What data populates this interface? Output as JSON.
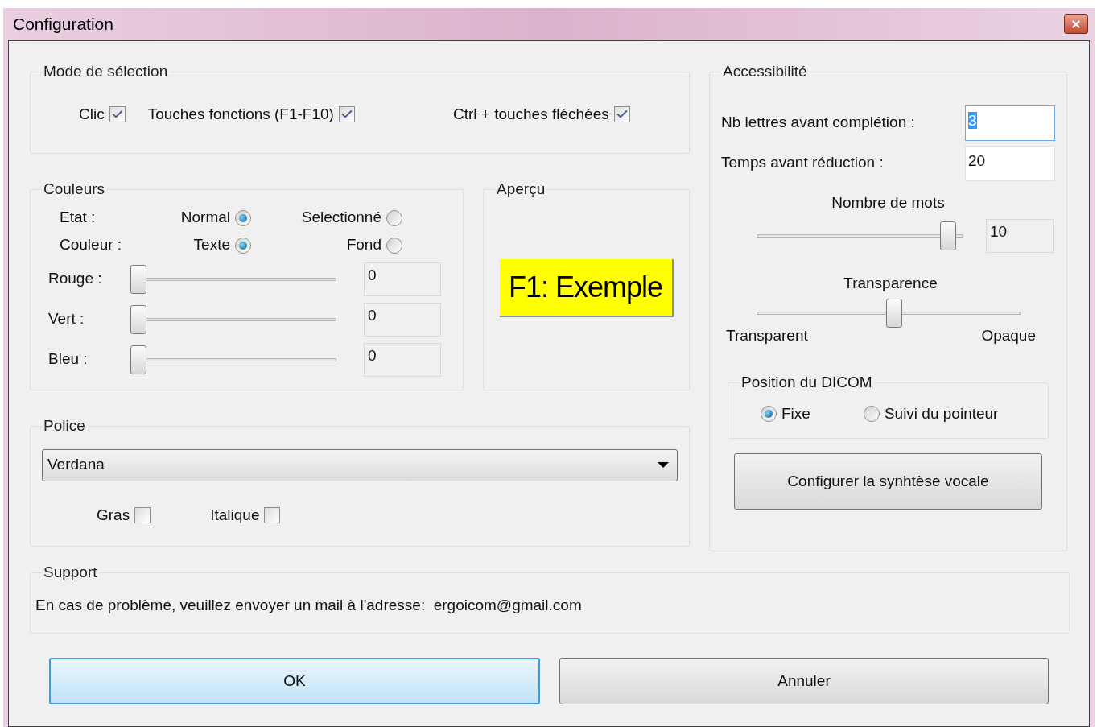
{
  "window": {
    "title": "Configuration"
  },
  "selection_mode": {
    "title": "Mode de sélection",
    "options": [
      {
        "label": "Clic",
        "checked": true
      },
      {
        "label": "Touches fonctions (F1-F10)",
        "checked": true
      },
      {
        "label": "Ctrl + touches fléchées",
        "checked": true
      }
    ]
  },
  "colors": {
    "title": "Couleurs",
    "rows": [
      {
        "label": "Etat :",
        "options": [
          {
            "label": "Normal",
            "selected": true
          },
          {
            "label": "Selectionné",
            "selected": false
          }
        ]
      },
      {
        "label": "Couleur :",
        "options": [
          {
            "label": "Texte",
            "selected": true
          },
          {
            "label": "Fond",
            "selected": false
          }
        ]
      }
    ],
    "channels": [
      {
        "label": "Rouge :",
        "level": 0,
        "value": "0"
      },
      {
        "label": "Vert :",
        "level": 0,
        "value": "0"
      },
      {
        "label": "Bleu :",
        "level": 0,
        "value": "0"
      }
    ]
  },
  "preview": {
    "title": "Aperçu",
    "sample": "F1: Exemple"
  },
  "font": {
    "title": "Police",
    "value": "Verdana",
    "options": [
      {
        "label": "Gras",
        "checked": false
      },
      {
        "label": "Italique",
        "checked": false
      }
    ]
  },
  "accessibility": {
    "title": "Accessibilité",
    "fields": [
      {
        "label": "Nb lettres avant complétion :",
        "value": "3",
        "focused": true
      },
      {
        "label": "Temps avant réduction :",
        "value": "20",
        "focused": false
      }
    ],
    "word_count": {
      "title": "Nombre de mots",
      "level": 0.96,
      "value": "10"
    },
    "transparency": {
      "title": "Transparence",
      "level": 0.52,
      "min_label": "Transparent",
      "max_label": "Opaque"
    },
    "dicom_position": {
      "title": "Position du DICOM",
      "options": [
        {
          "label": "Fixe",
          "selected": true
        },
        {
          "label": "Suivi du pointeur",
          "selected": false
        }
      ]
    },
    "voice_button": "Configurer la synhtèse vocale"
  },
  "support": {
    "title": "Support",
    "message": "En cas de problème, veuillez envoyer un mail à l'adresse:  ergoicom@gmail.com"
  },
  "buttons": [
    {
      "label": "OK",
      "default": true
    },
    {
      "label": "Annuler",
      "default": false
    }
  ]
}
